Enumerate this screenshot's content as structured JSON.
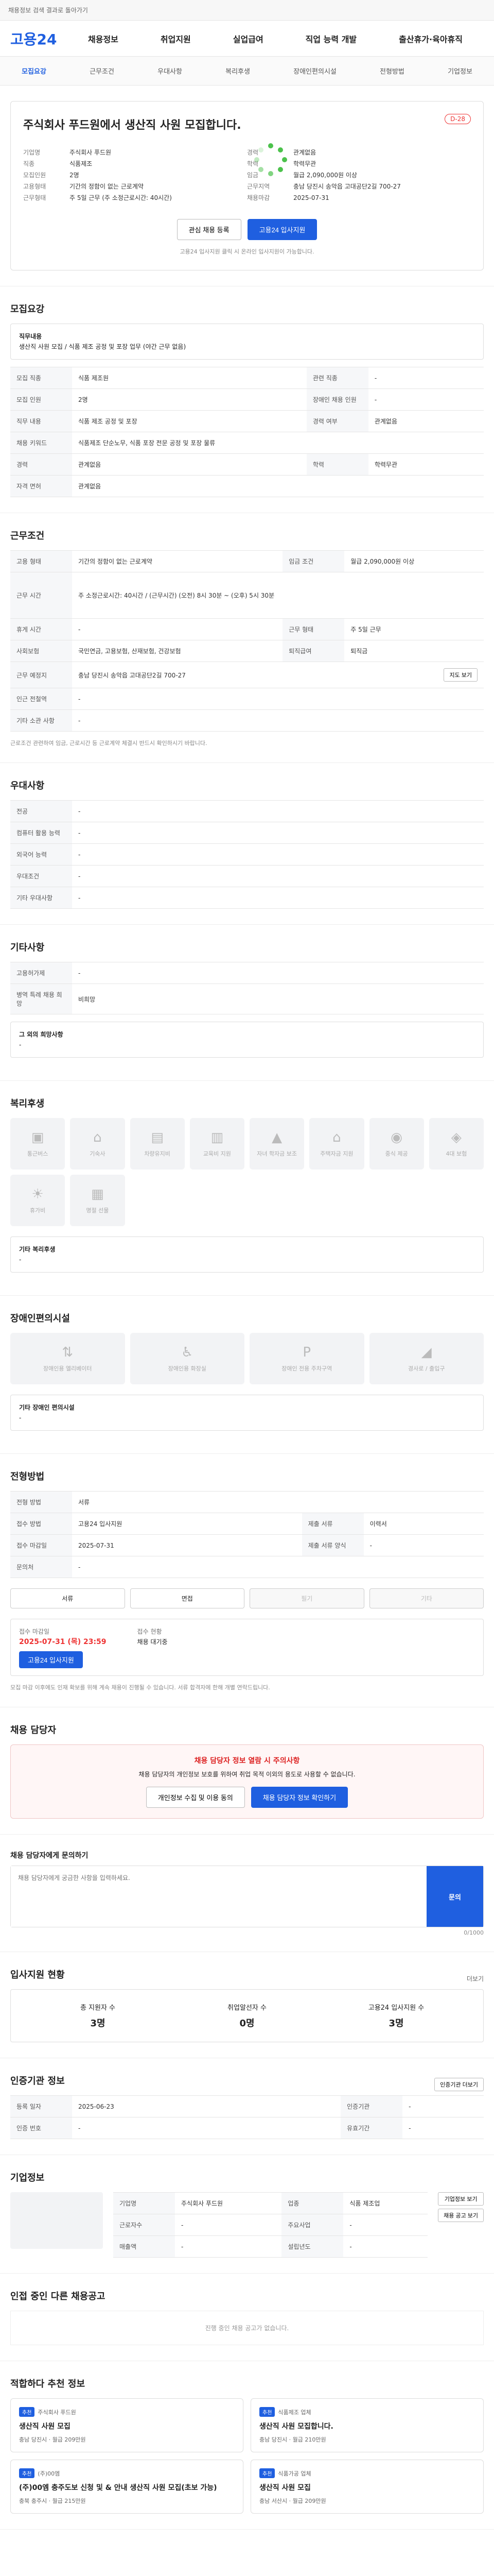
{
  "topbar": {
    "notice": "채용정보 검색 결과로 돌아가기"
  },
  "header": {
    "logo": "고용24",
    "gnb": [
      "채용정보",
      "취업지원",
      "실업급여",
      "직업 능력 개발",
      "출산휴가·육아휴직"
    ]
  },
  "subnav": {
    "items": [
      "모집요강",
      "근무조건",
      "우대사항",
      "복리후생",
      "장애인편의시설",
      "전형방법",
      "기업정보"
    ],
    "active": 0
  },
  "summary": {
    "title": "주식회사 푸드원에서 생산직 사원 모집합니다.",
    "tag": "D-28",
    "left": [
      {
        "k": "기업명",
        "v": "주식회사 푸드원"
      },
      {
        "k": "직종",
        "v": "식품제조"
      },
      {
        "k": "모집인원",
        "v": "2명"
      },
      {
        "k": "고용형태",
        "v": "기간의 정함이 없는 근로계약"
      },
      {
        "k": "근무형태",
        "v": "주 5일 근무 (주 소정근로시간: 40시간)"
      }
    ],
    "right": [
      {
        "k": "경력",
        "v": "관계없음"
      },
      {
        "k": "학력",
        "v": "학력무관"
      },
      {
        "k": "임금",
        "v": "월급 2,090,000원 이상"
      },
      {
        "k": "근무지역",
        "v": "충남 당진시 송악읍 고대공단2길 700-27"
      },
      {
        "k": "채용마감",
        "v": "2025-07-31"
      }
    ],
    "interest_btn": "관심 채용 등록",
    "apply_btn": "고용24 입사지원",
    "note": "고용24 입사지원 클릭 시 온라인 입사지원이 가능합니다."
  },
  "recruit": {
    "title": "모집요강",
    "duty_label": "직무내용",
    "duty": "생산직 사원 모집 / 식품 제조 공정 및 포장 업무 (야간 근무 없음)",
    "rows": [
      {
        "th": "모집 직종",
        "td": "식품 제조원",
        "th2": "관련 직종",
        "td2": "-"
      },
      {
        "th": "모집 인원",
        "td": "2명",
        "th2": "장애인 채용 인원",
        "td2": "-"
      },
      {
        "th": "직무 내용",
        "td": "식품 제조 공정 및 포장",
        "th2": "경력 여부",
        "td2": "관계없음"
      },
      {
        "th": "채용 키워드",
        "td": "식품제조 단순노무, 식품 포장 전문 공정 및 포장 물류",
        "th2": "",
        "td2": ""
      },
      {
        "th": "경력",
        "td": "관계없음",
        "th2": "학력",
        "td2": "학력무관"
      },
      {
        "th": "자격 면허",
        "td": "관계없음",
        "th2": "",
        "td2": ""
      }
    ]
  },
  "conditions": {
    "title": "근무조건",
    "rows": [
      {
        "th": "고용 형태",
        "td": "기간의 정함이 없는 근로계약",
        "th2": "임금 조건",
        "td2": "월급 2,090,000원 이상"
      },
      {
        "th": "근무 시간",
        "td": "주 소정근로시간: 40시간 / (근무시간) (오전) 8시 30분 ~ (오후) 5시 30분",
        "th2": "",
        "td2": ""
      },
      {
        "th": "휴게 시간",
        "td": "-",
        "th2": "근무 형태",
        "td2": "주 5일 근무"
      },
      {
        "th": "사회보험",
        "td": "국민연금, 고용보험, 산재보험, 건강보험",
        "th2": "퇴직급여",
        "td2": "퇴직금"
      },
      {
        "th": "근무 예정지",
        "td": "충남 당진시 송악읍 고대공단2길 700-27",
        "th2": "",
        "td2": ""
      },
      {
        "th": "인근 전철역",
        "td": "-",
        "th2": "",
        "td2": ""
      },
      {
        "th": "기타 소관 사항",
        "td": "-",
        "th2": "",
        "td2": ""
      }
    ],
    "map_btn": "지도 보기",
    "note": "근로조건 관련하여 임금, 근로시간 등 근로계약 체결시 반드시 확인하시기 바랍니다."
  },
  "preference": {
    "title": "우대사항",
    "rows": [
      {
        "th": "전공",
        "td": "-"
      },
      {
        "th": "컴퓨터 활용 능력",
        "td": "-"
      },
      {
        "th": "외국어 능력",
        "td": "-"
      },
      {
        "th": "우대조건",
        "td": "-"
      },
      {
        "th": "기타 우대사항",
        "td": "-"
      }
    ]
  },
  "other": {
    "title": "기타사항",
    "rows": [
      {
        "th": "고용허가제",
        "td": "-"
      },
      {
        "th": "병역 특례 채용 희망",
        "td": "비희망"
      }
    ],
    "extra_label": "그 외의 희망사항",
    "extra": "-"
  },
  "welfare": {
    "title": "복리후생",
    "items": [
      "통근버스",
      "기숙사",
      "차량유지비",
      "교육비 지원",
      "자녀 학자금 보조",
      "주택자금 지원",
      "중식 제공",
      "4대 보험",
      "휴가비",
      "명절 선물"
    ],
    "other_label": "기타 복리후생",
    "other": "-"
  },
  "facility": {
    "title": "장애인편의시설",
    "items": [
      "장애인용 엘리베이터",
      "장애인용 화장실",
      "장애인 전용 주차구역",
      "경사로 / 출입구"
    ],
    "other_label": "기타 장애인 편의시설",
    "other": "-"
  },
  "process": {
    "title": "전형방법",
    "rows": [
      {
        "th": "전형 방법",
        "td": "서류",
        "th2": "",
        "td2": ""
      },
      {
        "th": "접수 방법",
        "td": "고용24 입사지원",
        "th2": "제출 서류",
        "td2": "이력서"
      },
      {
        "th": "접수 마감일",
        "td": "2025-07-31",
        "th2": "제출 서류 양식",
        "td2": "-"
      },
      {
        "th": "문의처",
        "td": "-",
        "th2": "",
        "td2": ""
      }
    ],
    "methods": [
      "서류",
      "면접",
      "필기",
      "기타"
    ],
    "deadline_label": "접수 마감일",
    "deadline": "2025-07-31 (목) 23:59",
    "status_label": "접수 현황",
    "status": "채용 대기중",
    "apply_btn": "고용24 입사지원",
    "notes": "모집 마감 이후에도 인재 확보를 위해 계속 채용이 진행될 수 있습니다. 서류 합격자에 한해 개별 연락드립니다."
  },
  "contact": {
    "title": "채용 담당자",
    "alert_title": "채용 담당자 정보 열람 시 주의사항",
    "alert_text": "채용 담당자의 개인정보 보호를 위하여 취업 목적 이외의 용도로 사용할 수 없습니다.",
    "btn1": "개인정보 수집 및 이용 동의",
    "btn2": "채용 담당자 정보 확인하기"
  },
  "qa": {
    "title": "채용 담당자에게 문의하기",
    "placeholder": "채용 담당자에게 궁금한 사항을 입력하세요.",
    "count": "0/1000",
    "send": "문의"
  },
  "stats": {
    "title": "입사지원 현황",
    "more": "더보기",
    "items": [
      {
        "k": "총 지원자 수",
        "v": "3명"
      },
      {
        "k": "취업알선자 수",
        "v": "0명"
      },
      {
        "k": "고용24 입사지원 수",
        "v": "3명"
      }
    ]
  },
  "auth": {
    "title": "인증기관 정보",
    "btn": "인증기관 더보기",
    "rows": [
      {
        "th": "등록 일자",
        "td": "2025-06-23",
        "th2": "인증기관",
        "td2": "-"
      },
      {
        "th": "인증 번호",
        "td": "-",
        "th2": "유효기간",
        "td2": "-"
      }
    ]
  },
  "company": {
    "title": "기업정보",
    "rows": [
      {
        "th": "기업명",
        "td": "주식회사 푸드원",
        "th2": "업종",
        "td2": "식품 제조업"
      },
      {
        "th": "근로자수",
        "td": "-",
        "th2": "주요사업",
        "td2": "-"
      },
      {
        "th": "매출액",
        "td": "-",
        "th2": "설립년도",
        "td2": "-"
      }
    ],
    "btn_info": "기업정보 보기",
    "btn_list": "채용 공고 보기"
  },
  "more_jobs": {
    "title": "인접 중인 다른 채용공고",
    "empty": "진행 중인 채용 공고가 없습니다."
  },
  "similar": {
    "title": "적합하다 추천 정보",
    "jobs": [
      {
        "badge": "추천",
        "title": "생산직 사원 모집",
        "company": "주식회사 푸드원",
        "meta": "충남 당진시 · 월급 209만원"
      },
      {
        "badge": "추천",
        "title": "생산직 사원 모집합니다.",
        "company": "식품제조 업체",
        "meta": "충남 당진시 · 월급 210만원"
      },
      {
        "badge": "추천",
        "title": "(주)00엠 충주도보 신청 및 & 안내 생산직 사원 모집(초보 가능)",
        "company": "(주)00엠",
        "meta": "충북 충주시 · 월급 215만원"
      },
      {
        "badge": "추천",
        "title": "생산직 사원 모집",
        "company": "식품가공 업체",
        "meta": "충남 서산시 · 월급 209만원"
      }
    ]
  }
}
